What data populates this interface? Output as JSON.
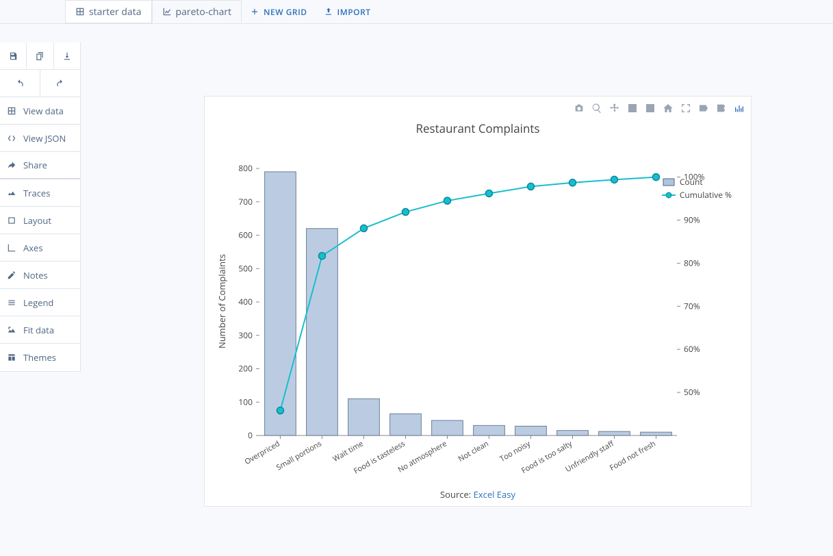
{
  "topbar": {
    "tab1": "starter data",
    "tab2": "pareto-chart",
    "new_grid": "NEW GRID",
    "import": "IMPORT"
  },
  "sidebar": {
    "view_data": "View data",
    "view_json": "View JSON",
    "share": "Share",
    "traces": "Traces",
    "layout": "Layout",
    "axes": "Axes",
    "notes": "Notes",
    "legend": "Legend",
    "fit_data": "Fit data",
    "themes": "Themes"
  },
  "chart": {
    "title": "Restaurant Complaints",
    "yaxis_title": "Number of Complaints",
    "source_label": "Source: ",
    "source_link": "Excel Easy"
  },
  "legend": {
    "count": "Count",
    "cumpct": "Cumulative %"
  },
  "chart_data": {
    "type": "bar",
    "title": "Restaurant Complaints",
    "ylabel": "Number of Complaints",
    "xlabel": "",
    "categories": [
      "Overpriced",
      "Small portions",
      "Wait time",
      "Food is tasteless",
      "No atmosphere",
      "Not clean",
      "Too noisy",
      "Food is too salty",
      "Unfriendly staff",
      "Food not fresh"
    ],
    "series": [
      {
        "name": "Count",
        "type": "bar",
        "values": [
          790,
          620,
          110,
          65,
          45,
          30,
          28,
          15,
          12,
          10
        ],
        "axis": "y"
      },
      {
        "name": "Cumulative %",
        "type": "line",
        "values": [
          45.8,
          81.7,
          88.1,
          91.9,
          94.5,
          96.2,
          97.8,
          98.7,
          99.4,
          100.0
        ],
        "axis": "y2"
      }
    ],
    "y_ticks": [
      0,
      100,
      200,
      300,
      400,
      500,
      600,
      700,
      800
    ],
    "y2_ticks": [
      "50%",
      "60%",
      "70%",
      "80%",
      "90%",
      "100%"
    ],
    "ylim": [
      0,
      800
    ],
    "y2lim": [
      40,
      102
    ],
    "colors": {
      "bar_fill": "#b0c4de",
      "bar_stroke": "#506784",
      "line": "#17becf"
    }
  }
}
